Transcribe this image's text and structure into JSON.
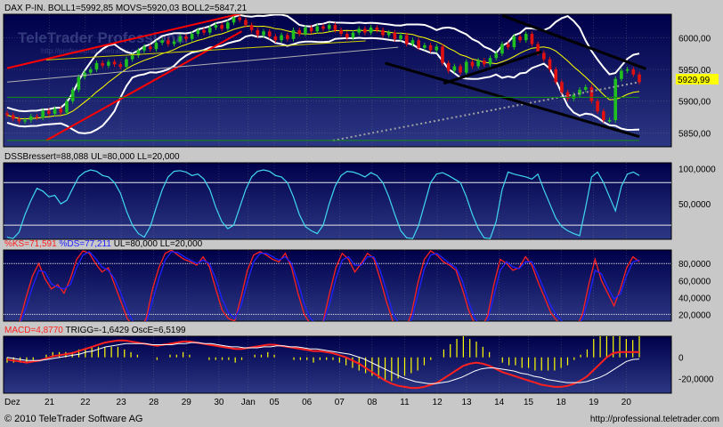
{
  "chart_data": [
    {
      "type": "line",
      "panel": "price",
      "header_label": "DAX P-IN.",
      "indicators": [
        {
          "label": "BOLL1=5992,85",
          "color": "#ffffff"
        },
        {
          "label": "MOVS=5920,03",
          "color": "#ffff00"
        },
        {
          "label": "BOLL2=5847,21",
          "color": "#ffffff"
        }
      ],
      "last_value_label": "5929,99",
      "y_ticks": [
        "6000,00",
        "5950,00",
        "5900,00",
        "5850,00"
      ],
      "y_tick_values": [
        6000,
        5950,
        5900,
        5850
      ],
      "ylim": [
        5828,
        6037
      ],
      "watermark": {
        "title": "TeleTrader Professional",
        "url": "http://professional.teletrader.com"
      },
      "close": [
        5878,
        5872,
        5868,
        5870,
        5876,
        5874,
        5885,
        5880,
        5888,
        5882,
        5900,
        5918,
        5938,
        5945,
        5950,
        5960,
        5956,
        5962,
        5958,
        5954,
        5966,
        5972,
        5980,
        5986,
        5982,
        5992,
        5996,
        5990,
        5994,
        6002,
        5998,
        6006,
        6012,
        6008,
        6016,
        6020,
        6014,
        6024,
        6032,
        6028,
        6020,
        6012,
        6004,
        6010,
        6002,
        5996,
        6004,
        5998,
        6012,
        6006,
        6016,
        6010,
        6018,
        6014,
        6020,
        6012,
        6006,
        6000,
        6008,
        6014,
        6008,
        6016,
        6012,
        6004,
        6008,
        5998,
        6004,
        5990,
        5996,
        5984,
        5988,
        5980,
        5986,
        5960,
        5948,
        5955,
        5945,
        5962,
        5955,
        5964,
        5958,
        5968,
        5975,
        5990,
        5985,
        6002,
        5996,
        6006,
        5990,
        5976,
        5966,
        5950,
        5930,
        5914,
        5904,
        5910,
        5918,
        5922,
        5900,
        5884,
        5870,
        5870,
        5935,
        5948,
        5950,
        5942,
        5930
      ]
    },
    {
      "type": "line",
      "panel": "dss_bressert",
      "indicator_label": "DSSBressert=88,088 UL=80,000 LL=20,000",
      "y_ticks": [
        "100,0000",
        "50,0000"
      ],
      "y_tick_values": [
        100,
        50
      ],
      "ylim": [
        0,
        108
      ],
      "levels": [
        80,
        20
      ],
      "values": [
        3,
        1,
        10,
        35,
        55,
        72,
        68,
        60,
        62,
        50,
        55,
        72,
        88,
        95,
        98,
        96,
        90,
        88,
        80,
        65,
        40,
        20,
        8,
        3,
        18,
        45,
        70,
        88,
        96,
        97,
        95,
        90,
        92,
        85,
        70,
        45,
        25,
        15,
        20,
        45,
        70,
        88,
        96,
        98,
        96,
        90,
        88,
        80,
        60,
        35,
        18,
        12,
        8,
        20,
        50,
        75,
        90,
        96,
        95,
        92,
        88,
        94,
        90,
        80,
        60,
        35,
        12,
        2,
        1,
        20,
        50,
        80,
        92,
        94,
        90,
        85,
        80,
        60,
        35,
        15,
        2,
        1,
        25,
        70,
        95,
        92,
        90,
        88,
        85,
        92,
        70,
        50,
        30,
        18,
        12,
        8,
        5,
        45,
        88,
        95,
        80,
        60,
        40,
        75,
        92,
        95,
        90
      ]
    },
    {
      "type": "line",
      "panel": "stochastic",
      "series": [
        {
          "name": "%KS=71,591",
          "color": "#ff2020",
          "values": [
            3,
            2,
            12,
            40,
            65,
            80,
            62,
            50,
            55,
            45,
            62,
            85,
            95,
            92,
            80,
            70,
            75,
            55,
            35,
            15,
            5,
            2,
            15,
            50,
            75,
            92,
            96,
            90,
            85,
            82,
            78,
            88,
            76,
            50,
            25,
            15,
            12,
            40,
            72,
            90,
            94,
            90,
            85,
            82,
            92,
            75,
            45,
            20,
            8,
            5,
            12,
            45,
            75,
            92,
            85,
            70,
            80,
            92,
            86,
            62,
            35,
            12,
            3,
            2,
            22,
            58,
            85,
            95,
            90,
            82,
            78,
            72,
            50,
            25,
            8,
            4,
            18,
            55,
            85,
            80,
            72,
            75,
            88,
            78,
            58,
            40,
            22,
            12,
            8,
            5,
            4,
            20,
            55,
            85,
            60,
            45,
            30,
            50,
            75,
            88,
            82
          ]
        },
        {
          "name": "%DS=77,211",
          "color": "#2020ff",
          "values": [
            4,
            3,
            8,
            28,
            52,
            72,
            70,
            56,
            52,
            50,
            55,
            75,
            90,
            94,
            86,
            76,
            72,
            62,
            45,
            25,
            10,
            4,
            10,
            36,
            62,
            84,
            94,
            93,
            88,
            84,
            80,
            84,
            80,
            62,
            38,
            22,
            15,
            30,
            58,
            82,
            92,
            92,
            88,
            84,
            88,
            80,
            58,
            32,
            15,
            8,
            10,
            32,
            62,
            84,
            88,
            78,
            78,
            88,
            88,
            72,
            48,
            22,
            8,
            4,
            14,
            44,
            74,
            90,
            92,
            86,
            80,
            75,
            60,
            35,
            15,
            6,
            12,
            42,
            72,
            82,
            76,
            74,
            82,
            82,
            66,
            48,
            30,
            18,
            10,
            7,
            5,
            14,
            40,
            72,
            68,
            52,
            38,
            44,
            66,
            82,
            84
          ]
        }
      ],
      "indicator_extra": "UL=80,000 LL=20,000",
      "y_ticks": [
        "80,0000",
        "60,0000",
        "40,0000",
        "20,0000"
      ],
      "y_tick_values": [
        80,
        60,
        40,
        20
      ],
      "ylim": [
        12,
        96
      ],
      "levels": [
        80,
        20
      ]
    },
    {
      "type": "line",
      "panel": "macd",
      "series": [
        {
          "name": "MACD=4,8770",
          "color": "#ff2020",
          "values": [
            -2,
            -3,
            -4,
            -5,
            -4,
            -3,
            -1,
            1,
            2,
            3,
            4,
            6,
            8,
            10,
            12,
            14,
            15,
            16,
            16,
            15,
            14,
            13,
            12,
            11,
            12,
            13,
            14,
            15,
            15,
            14,
            13,
            12,
            11,
            10,
            9,
            8,
            8,
            9,
            10,
            11,
            12,
            12,
            11,
            10,
            9,
            8,
            7,
            6,
            6,
            5,
            4,
            2,
            0,
            -3,
            -6,
            -10,
            -14,
            -18,
            -22,
            -25,
            -27,
            -28,
            -29,
            -29,
            -28,
            -26,
            -24,
            -20,
            -16,
            -12,
            -8,
            -6,
            -5,
            -6,
            -8,
            -11,
            -14,
            -16,
            -18,
            -20,
            -22,
            -24,
            -26,
            -27,
            -28,
            -28,
            -27,
            -25,
            -22,
            -18,
            -12,
            -6,
            0,
            4,
            5,
            5,
            5,
            5
          ]
        },
        {
          "name": "TRIGG=-1,6429",
          "color": "#ffffff",
          "values": [
            0,
            -1,
            -2,
            -3,
            -3,
            -3,
            -2,
            -1,
            0,
            1,
            2,
            3,
            5,
            6,
            8,
            10,
            11,
            12,
            13,
            13,
            13,
            13,
            12,
            12,
            12,
            12,
            13,
            13,
            14,
            14,
            13,
            13,
            12,
            11,
            10,
            10,
            9,
            9,
            9,
            10,
            10,
            11,
            11,
            10,
            10,
            9,
            8,
            8,
            7,
            6,
            5,
            4,
            3,
            1,
            -1,
            -4,
            -7,
            -10,
            -13,
            -16,
            -19,
            -21,
            -23,
            -24,
            -25,
            -25,
            -24,
            -23,
            -21,
            -19,
            -16,
            -13,
            -11,
            -10,
            -10,
            -11,
            -12,
            -13,
            -15,
            -16,
            -18,
            -19,
            -21,
            -22,
            -23,
            -24,
            -24,
            -24,
            -23,
            -21,
            -19,
            -16,
            -12,
            -8,
            -4,
            -2,
            -1.6
          ]
        }
      ],
      "osc_label": "OscE=6,5199",
      "osc_color": "#ffff00",
      "y_ticks": [
        "0",
        "-20,0000"
      ],
      "y_tick_values": [
        0,
        -20
      ],
      "ylim": [
        -34,
        20
      ]
    }
  ],
  "x_axis": {
    "labels": [
      "Dez",
      "21",
      "22",
      "23",
      "28",
      "29",
      "30",
      "Jan",
      "05",
      "06",
      "07",
      "08",
      "11",
      "12",
      "13",
      "14",
      "15",
      "18",
      "19",
      "20"
    ],
    "positions": [
      0,
      6.5,
      12,
      17.5,
      22.5,
      27.5,
      32.5,
      37,
      41,
      46,
      51,
      56,
      61,
      66,
      70.5,
      75.5,
      80,
      85,
      90,
      95
    ]
  },
  "footer": {
    "copyright": "© 2010 TeleTrader Software AG",
    "url": "http://professional.teletrader.com"
  },
  "colors": {
    "panel_top": "#000050",
    "panel_bottom": "#2a3580",
    "frame": "#c8c8c8",
    "grid": "#8a8a8a",
    "ul_ll_line": "#e8e8e8",
    "price_highlight": "#ffff00"
  }
}
